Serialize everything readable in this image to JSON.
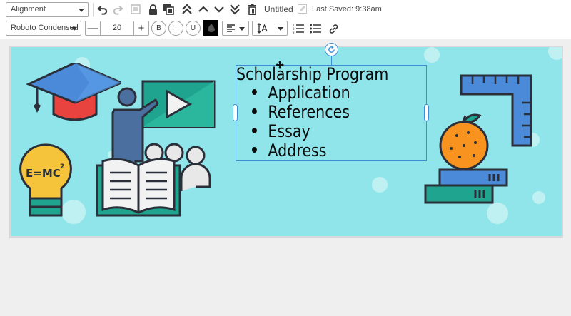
{
  "toolbar1": {
    "alignment_select": "Alignment",
    "document_title": "Untitled",
    "last_saved": "Last Saved: 9:38am"
  },
  "toolbar2": {
    "font_family": "Roboto Condensed",
    "font_size": "20",
    "bold_label": "B",
    "italic_label": "I",
    "underline_label": "U",
    "color_swatch": "#000000"
  },
  "canvas": {
    "background": "#8fe5ea",
    "textbox": {
      "title": "Scholarship Program",
      "bullets": [
        "Application",
        "References",
        "Essay",
        "Address"
      ]
    }
  },
  "icons": [
    "undo-icon",
    "redo-icon",
    "frame-icon",
    "lock-icon",
    "duplicate-icon",
    "bring-to-front-icon",
    "bring-forward-icon",
    "send-backward-icon",
    "send-to-back-icon",
    "trash-icon",
    "edit-title-icon",
    "text-align-icon",
    "line-spacing-icon",
    "numbered-list-icon",
    "bullet-list-icon",
    "link-icon",
    "move-icon",
    "rotate-icon"
  ]
}
